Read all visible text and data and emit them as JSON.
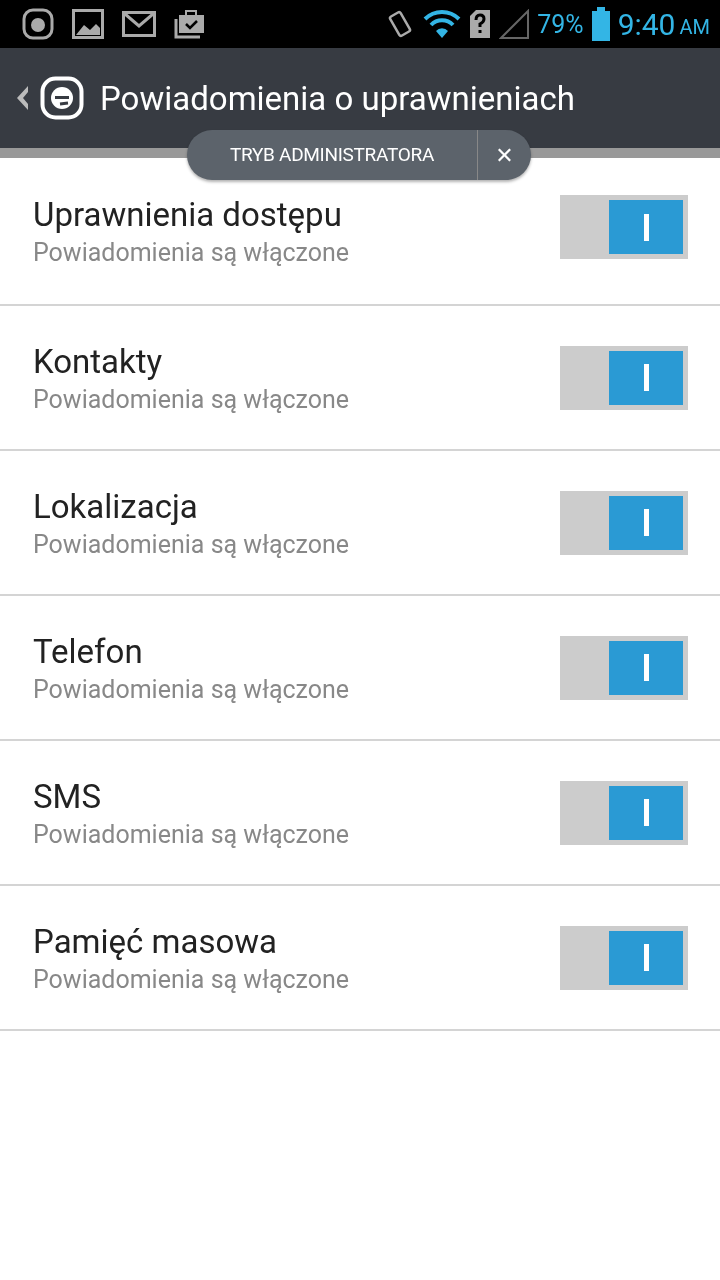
{
  "status_bar": {
    "battery": "79%",
    "time": "9:40",
    "ampm": "AM"
  },
  "header": {
    "title": "Powiadomienia o uprawnieniach"
  },
  "admin_badge": {
    "label": "TRYB ADMINISTRATORA",
    "close": "✕"
  },
  "settings": [
    {
      "title": "Uprawnienia dostępu",
      "subtitle": "Powiadomienia są włączone",
      "on": true
    },
    {
      "title": "Kontakty",
      "subtitle": "Powiadomienia są włączone",
      "on": true
    },
    {
      "title": "Lokalizacja",
      "subtitle": "Powiadomienia są włączone",
      "on": true
    },
    {
      "title": "Telefon",
      "subtitle": "Powiadomienia są włączone",
      "on": true
    },
    {
      "title": "SMS",
      "subtitle": "Powiadomienia są włączone",
      "on": true
    },
    {
      "title": "Pamięć masowa",
      "subtitle": "Powiadomienia są włączone",
      "on": true
    }
  ]
}
